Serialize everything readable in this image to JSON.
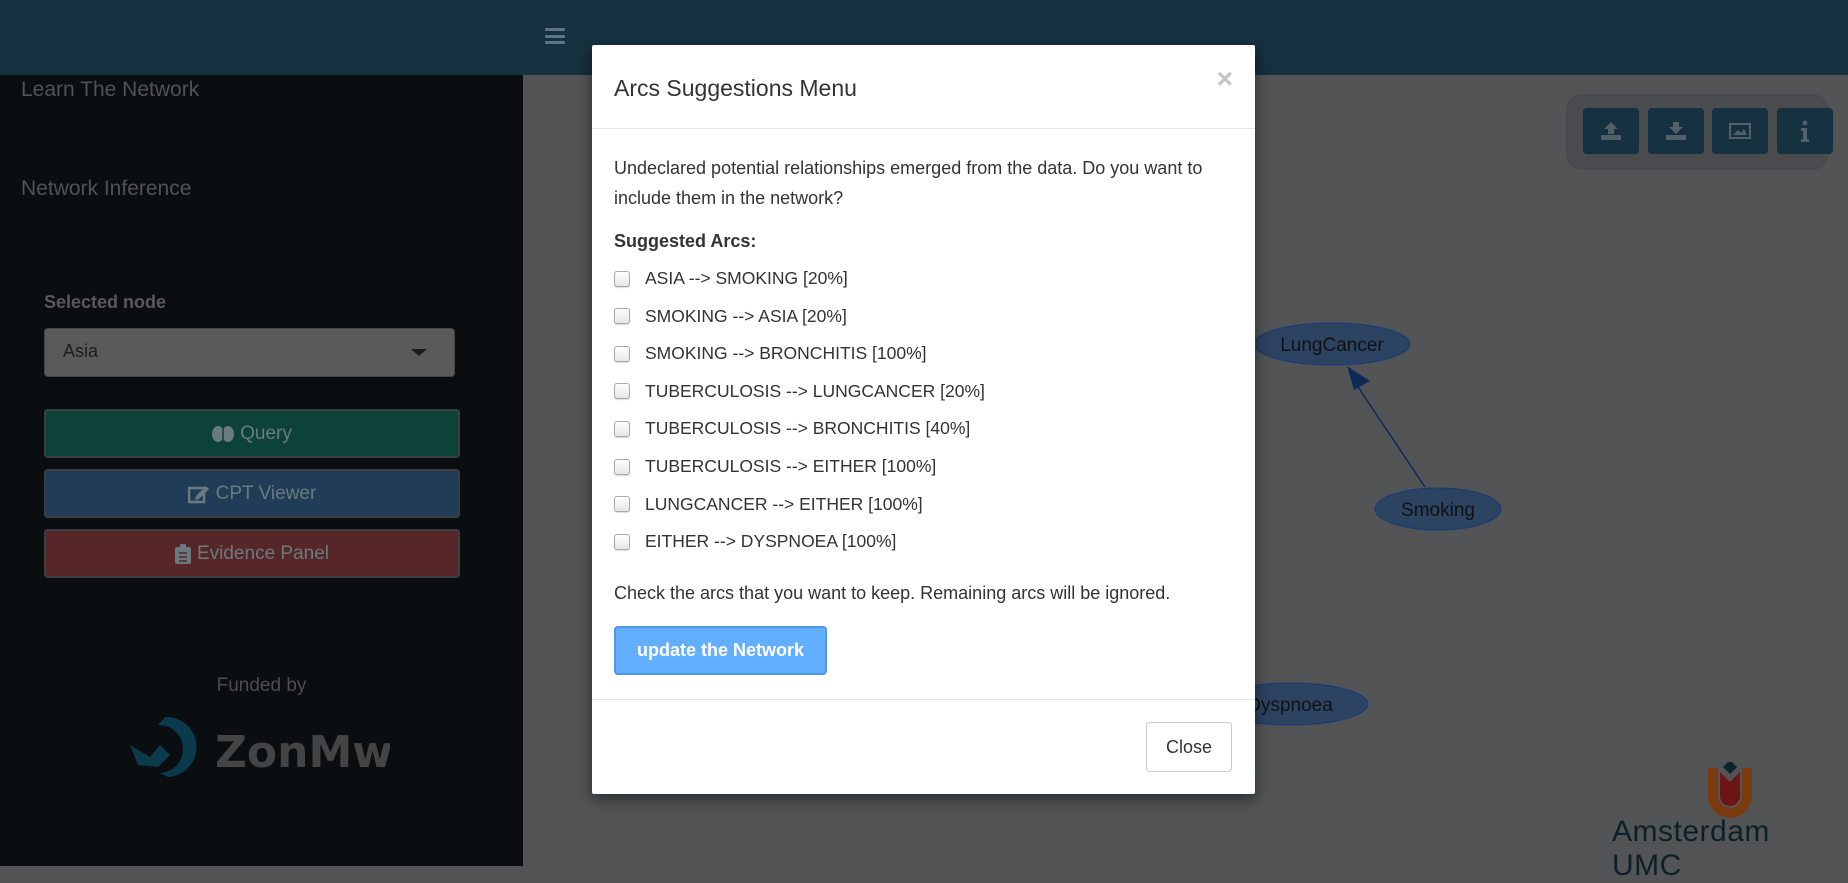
{
  "sidebar": {
    "learn_title": "Learn The Network",
    "inference_title": "Network Inference",
    "selected_node_label": "Selected node",
    "selected_node_value": "Asia",
    "buttons": [
      {
        "label": "Query",
        "icon": "brain-icon",
        "color": "#0c4238"
      },
      {
        "label": "CPT Viewer",
        "icon": "edit-icon",
        "color": "#213c56"
      },
      {
        "label": "Evidence Panel",
        "icon": "clipboard-icon",
        "color": "#562628"
      }
    ],
    "funded_by": "Funded by",
    "funder_logo": "ZonMw"
  },
  "toolbar": {
    "buttons": [
      "upload-icon",
      "download-icon",
      "image-icon",
      "info-icon"
    ]
  },
  "graph": {
    "nodes": [
      "LungCancer",
      "Smoking",
      "Dyspnoea"
    ],
    "edges": [
      {
        "from": "Smoking",
        "to": "LungCancer"
      }
    ]
  },
  "modal": {
    "title": "Arcs Suggestions Menu",
    "close_symbol": "×",
    "intro": "Undeclared potential relationships emerged from the data. Do you want to include them in the network?",
    "subtitle": "Suggested Arcs:",
    "arcs": [
      {
        "label": "ASIA --> SMOKING [20%]",
        "checked": false
      },
      {
        "label": "SMOKING --> ASIA [20%]",
        "checked": false
      },
      {
        "label": "SMOKING --> BRONCHITIS [100%]",
        "checked": false
      },
      {
        "label": "TUBERCULOSIS --> LUNGCANCER [20%]",
        "checked": false
      },
      {
        "label": "TUBERCULOSIS --> BRONCHITIS [40%]",
        "checked": false
      },
      {
        "label": "TUBERCULOSIS --> EITHER [100%]",
        "checked": false
      },
      {
        "label": "LUNGCANCER --> EITHER [100%]",
        "checked": false
      },
      {
        "label": "EITHER --> DYSPNOEA [100%]",
        "checked": false
      }
    ],
    "note": "Check the arcs that you want to keep. Remaining arcs will be ignored.",
    "update_button": "update the Network",
    "close_button": "Close"
  },
  "branding": {
    "logo_text": "Amsterdam UMC"
  }
}
